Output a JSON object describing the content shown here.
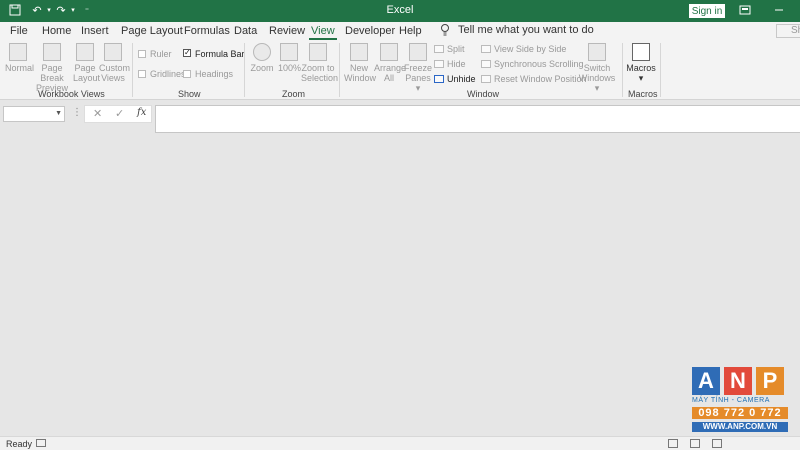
{
  "window": {
    "title": "Excel",
    "signin_label": "Sign in"
  },
  "menu": {
    "tabs": [
      "File",
      "Home",
      "Insert",
      "Page Layout",
      "Formulas",
      "Data",
      "Review",
      "View",
      "Developer",
      "Help"
    ],
    "active_tab": "View",
    "tell_me": "Tell me what you want to do",
    "share_label": "Sh"
  },
  "ribbon": {
    "workbook_views": {
      "label": "Workbook Views",
      "buttons": [
        {
          "line1": "Normal",
          "line2": ""
        },
        {
          "line1": "Page Break",
          "line2": "Preview"
        },
        {
          "line1": "Page",
          "line2": "Layout"
        },
        {
          "line1": "Custom",
          "line2": "Views"
        }
      ]
    },
    "show": {
      "label": "Show",
      "ruler": "Ruler",
      "formula_bar": "Formula Bar",
      "gridlines": "Gridlines",
      "headings": "Headings"
    },
    "zoom": {
      "label": "Zoom",
      "zoom": "Zoom",
      "hundred": "100%",
      "zoom_sel_1": "Zoom to",
      "zoom_sel_2": "Selection"
    },
    "window": {
      "label": "Window",
      "new_window_1": "New",
      "new_window_2": "Window",
      "arrange_1": "Arrange",
      "arrange_2": "All",
      "freeze_1": "Freeze",
      "freeze_2": "Panes ▾",
      "split": "Split",
      "hide": "Hide",
      "unhide": "Unhide",
      "side_by_side": "View Side by Side",
      "sync_scroll": "Synchronous Scrolling",
      "reset_pos": "Reset Window Position",
      "switch_1": "Switch",
      "switch_2": "Windows ▾"
    },
    "macros": {
      "label": "Macros",
      "button": "Macros",
      "caret": "▾"
    }
  },
  "formula_bar": {
    "cancel": "✕",
    "enter": "✓",
    "fx": "fx",
    "dots": "⋮"
  },
  "statusbar": {
    "status": "Ready"
  },
  "watermark": {
    "letters": [
      "A",
      "N",
      "P"
    ],
    "colors": [
      "#2f6cb6",
      "#e24a3b",
      "#e58b2a"
    ],
    "tagline": "MÁY TÍNH - CAMERA",
    "phone": "098 772 0 772",
    "site": "WWW.ANP.COM.VN"
  },
  "colors": {
    "accent": "#217346"
  }
}
